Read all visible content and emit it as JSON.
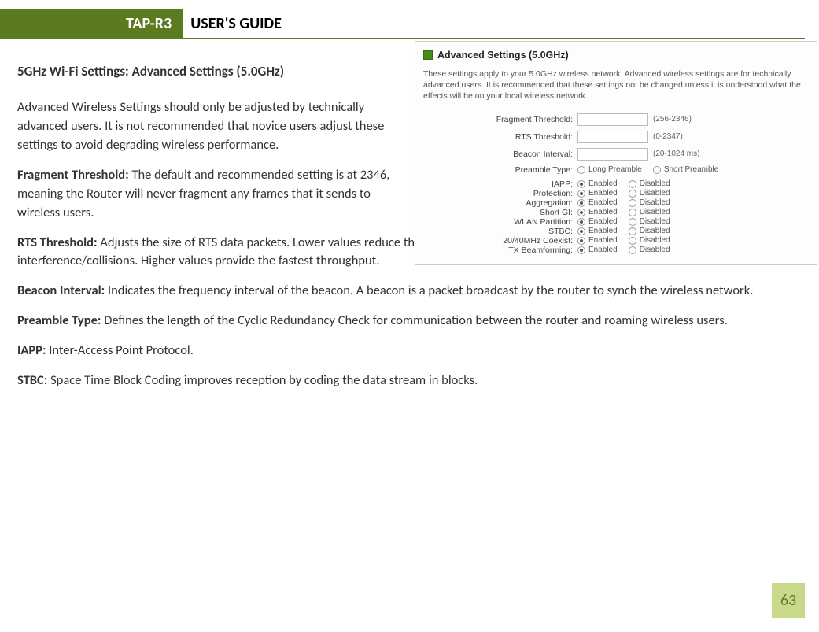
{
  "header": {
    "model": "TAP-R3",
    "title": "USER'S GUIDE"
  },
  "page_number": "63",
  "section_title": "5GHz Wi-Fi Settings: Advanced Settings (5.0GHz)",
  "paragraphs": {
    "intro": "Advanced Wireless Settings should only be adjusted by technically advanced users. It is not recommended that novice users adjust these settings to avoid degrading wireless performance.",
    "frag_label": "Fragment Threshold: ",
    "frag_text": "The default and recommended setting is at 2346, meaning the Router will never fragment any frames that it sends to wireless users.",
    "rts_label": "RTS Threshold: ",
    "rts_text": "Adjusts the size of RTS data packets. Lower values reduce throughput, but allow the system to recover quicker from interference/collisions. Higher values provide the fastest throughput.",
    "beacon_label": "Beacon Interval: ",
    "beacon_text": "Indicates the frequency interval of the beacon. A beacon is a packet broadcast by the router to synch the wireless network.",
    "preamble_label": "Preamble Type: ",
    "preamble_text": "Defines the length of the Cyclic Redundancy Check for communication between the router and roaming wireless users.",
    "iapp_label": "IAPP: ",
    "iapp_text": "Inter-Access Point Protocol.",
    "stbc_label": "STBC: ",
    "stbc_text": "Space Time Block Coding improves reception by coding the data stream in blocks."
  },
  "panel": {
    "title": "Advanced Settings (5.0GHz)",
    "description": "These settings apply to your 5.0GHz wireless network. Advanced wireless settings are for technically advanced users. It is recommended that these settings not be changed unless it is understood what the effects will be on your local wireless network.",
    "fields": {
      "fragment": {
        "label": "Fragment Threshold:",
        "hint": "(256-2346)",
        "value": ""
      },
      "rts": {
        "label": "RTS Threshold:",
        "hint": "(0-2347)",
        "value": ""
      },
      "beacon": {
        "label": "Beacon Interval:",
        "hint": "(20-1024 ms)",
        "value": ""
      },
      "preamble": {
        "label": "Preamble Type:",
        "opt1": "Long Preamble",
        "opt2": "Short Preamble"
      }
    },
    "radios": [
      {
        "label": "IAPP:",
        "enabled": true
      },
      {
        "label": "Protection:",
        "enabled": true
      },
      {
        "label": "Aggregation:",
        "enabled": true
      },
      {
        "label": "Short GI:",
        "enabled": true
      },
      {
        "label": "WLAN Partition:",
        "enabled": true
      },
      {
        "label": "STBC:",
        "enabled": true
      },
      {
        "label": "20/40MHz Coexist:",
        "enabled": true
      },
      {
        "label": "TX Beamforming:",
        "enabled": true
      }
    ],
    "opt_enabled": "Enabled",
    "opt_disabled": "Disabled"
  }
}
